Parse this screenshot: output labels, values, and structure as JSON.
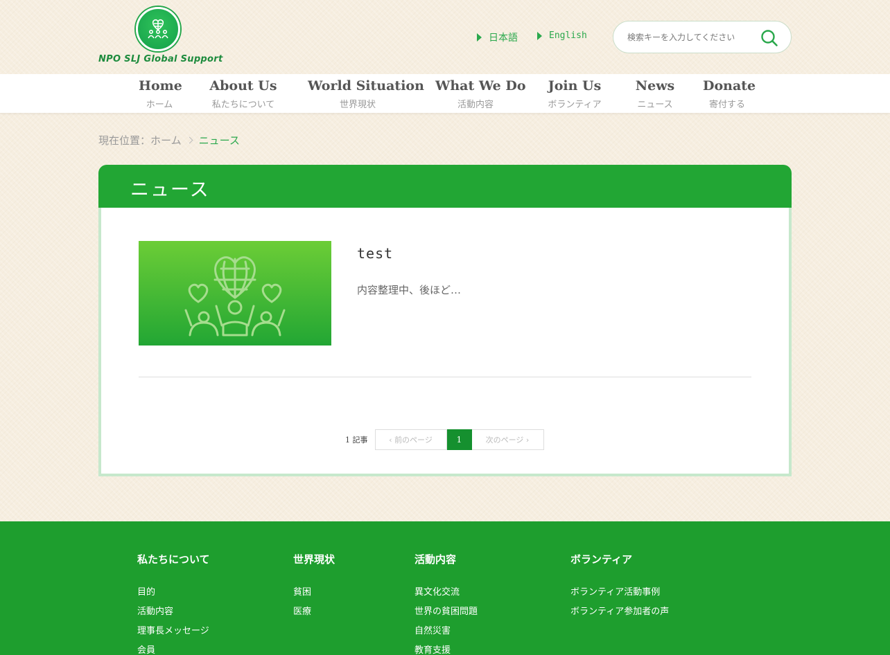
{
  "header": {
    "logo_text": "NPO SLJ Global Support",
    "lang_ja": "日本語",
    "lang_en": "English",
    "search_placeholder": "検索キーを入力してください"
  },
  "nav": [
    {
      "en": "Home",
      "ja": "ホーム"
    },
    {
      "en": "About Us",
      "ja": "私たちについて"
    },
    {
      "en": "World Situation",
      "ja": "世界現状"
    },
    {
      "en": "What We Do",
      "ja": "活動内容"
    },
    {
      "en": "Join Us",
      "ja": "ボランティア"
    },
    {
      "en": "News",
      "ja": "ニュース"
    },
    {
      "en": "Donate",
      "ja": "寄付する"
    }
  ],
  "breadcrumb": {
    "prefix": "現在位置：",
    "home": "ホーム",
    "current": "ニュース"
  },
  "panel": {
    "title": "ニュース",
    "post": {
      "title": "test",
      "excerpt": "内容整理中、後ほど…"
    },
    "pager": {
      "count": "1 記事",
      "prev": "前のページ",
      "current": "1",
      "next": "次のページ"
    }
  },
  "footer": {
    "columns": [
      {
        "title": "私たちについて",
        "links": [
          "目的",
          "活動内容",
          "理事長メッセージ",
          "会員"
        ]
      },
      {
        "title": "世界現状",
        "links": [
          "貧困",
          "医療"
        ]
      },
      {
        "title": "活動内容",
        "links": [
          "異文化交流",
          "世界の貧困問題",
          "自然災害",
          "教育支援"
        ]
      },
      {
        "title": "ボランティア",
        "links": [
          "ボランティア活動事例",
          "ボランティア参加者の声"
        ]
      }
    ]
  },
  "colors": {
    "brand_green": "#22a634",
    "footer_green": "#1e9e2e",
    "accent_text_green": "#2aa84c"
  },
  "icons": {
    "logo": "heart-globe-people-icon",
    "search": "search-icon",
    "thumbnail": "heart-globe-people-icon"
  }
}
